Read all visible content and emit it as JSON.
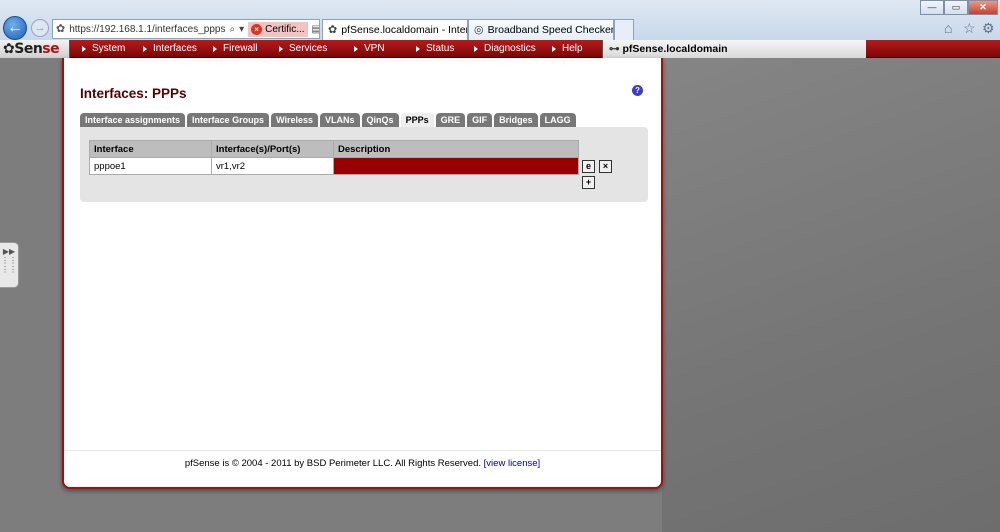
{
  "browser": {
    "url": "https://192.168.1.1/interfaces_ppps",
    "cert_label": "Certific...",
    "tabs": [
      {
        "label": "pfSense.localdomain - Inter...",
        "active": true
      },
      {
        "label": "Broadband Speed Checker - T...",
        "active": false
      }
    ],
    "window_controls": [
      "—",
      "▭",
      "✕"
    ],
    "icons": [
      "home-icon",
      "star-icon",
      "gear-icon"
    ]
  },
  "logo": {
    "pre": "Sen",
    "accent": "se"
  },
  "menu": {
    "items": [
      "System",
      "Interfaces",
      "Firewall",
      "Services",
      "VPN",
      "Status",
      "Diagnostics",
      "Help"
    ],
    "hostname": "pfSense.localdomain"
  },
  "page": {
    "title": "Interfaces: PPPs",
    "help": "?",
    "tabs": [
      {
        "label": "Interface assignments",
        "active": false
      },
      {
        "label": "Interface Groups",
        "active": false
      },
      {
        "label": "Wireless",
        "active": false
      },
      {
        "label": "VLANs",
        "active": false
      },
      {
        "label": "QinQs",
        "active": false
      },
      {
        "label": "PPPs",
        "active": true
      },
      {
        "label": "GRE",
        "active": false
      },
      {
        "label": "GIF",
        "active": false
      },
      {
        "label": "Bridges",
        "active": false
      },
      {
        "label": "LAGG",
        "active": false
      }
    ],
    "table": {
      "headers": [
        "Interface",
        "Interface(s)/Port(s)",
        "Description"
      ],
      "rows": [
        {
          "interface": "pppoe1",
          "ports": "vr1,vr2",
          "description": ""
        }
      ]
    }
  },
  "footer": {
    "text": "pfSense is © 2004 - 2011 by BSD Perimeter LLC. All Rights Reserved.",
    "link": "[view license]"
  },
  "colors": {
    "accent": "#b41b1b",
    "title": "#550000",
    "desc_cell": "#990000"
  }
}
